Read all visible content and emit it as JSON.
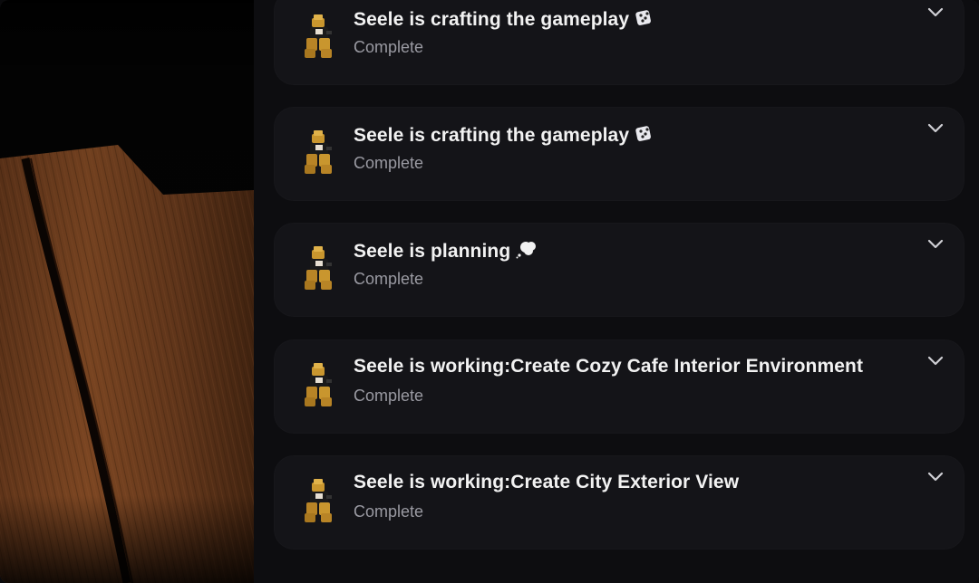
{
  "tasks": [
    {
      "title": "Seele is crafting the gameplay",
      "emoji": "dice-icon",
      "status": "Complete"
    },
    {
      "title": "Seele is crafting the gameplay",
      "emoji": "dice-icon",
      "status": "Complete"
    },
    {
      "title": "Seele is planning",
      "emoji": "thought-bubble-icon",
      "status": "Complete"
    },
    {
      "title": "Seele is working:Create Cozy Cafe Interior Environment",
      "emoji": "",
      "status": "Complete"
    },
    {
      "title": "Seele is working:Create City Exterior View",
      "emoji": "",
      "status": "Complete"
    }
  ],
  "colors": {
    "card_bg": "#141418",
    "title": "#f2f2f2",
    "status": "#9a9aa2",
    "accent_gold": "#c9962e"
  }
}
